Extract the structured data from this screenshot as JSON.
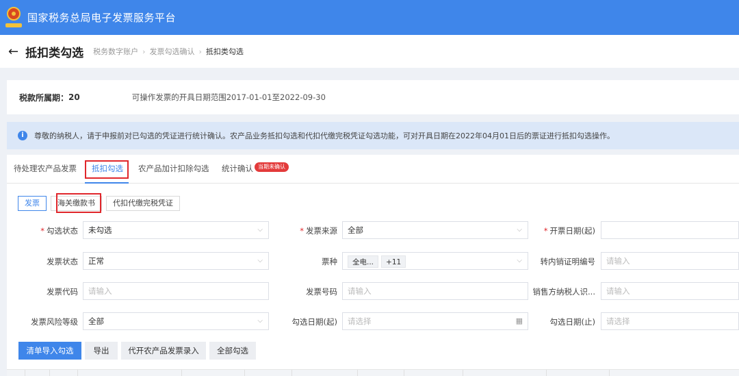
{
  "app": {
    "title": "国家税务总局电子发票服务平台"
  },
  "header": {
    "back_icon": "←",
    "title": "抵扣类勾选",
    "breadcrumbs": [
      "税务数字账户",
      "发票勾选确认",
      "抵扣类勾选"
    ],
    "sep": "›"
  },
  "period": {
    "label": "税款所属期：",
    "value": "20",
    "range_text": "可操作发票的开具日期范围2017-01-01至2022-09-30"
  },
  "notice": {
    "icon": "i",
    "text": "尊敬的纳税人，请于申报前对已勾选的凭证进行统计确认。农产品业务抵扣勾选和代扣代缴完税凭证勾选功能，可对开具日期在2022年04月01日后的票证进行抵扣勾选操作。"
  },
  "tabs": [
    {
      "label": "待处理农产品发票"
    },
    {
      "label": "抵扣勾选"
    },
    {
      "label": "农产品加计扣除勾选"
    },
    {
      "label": "统计确认"
    }
  ],
  "badge": "当期未确认",
  "subtabs": [
    {
      "label": "发票"
    },
    {
      "label": "海关缴款书"
    },
    {
      "label": "代扣代缴完税凭证"
    }
  ],
  "form": {
    "check_status": {
      "label": "勾选状态",
      "value": "未勾选"
    },
    "invoice_source": {
      "label": "发票来源",
      "value": "全部"
    },
    "issue_date_start": {
      "label": "开票日期(起)",
      "value": ""
    },
    "invoice_status": {
      "label": "发票状态",
      "value": "正常"
    },
    "ticket_type": {
      "label": "票种",
      "chip": "全电...",
      "more": "+11"
    },
    "transfer_cert_no": {
      "label": "转内销证明编号",
      "placeholder": "请输入"
    },
    "invoice_code": {
      "label": "发票代码",
      "placeholder": "请输入"
    },
    "invoice_number": {
      "label": "发票号码",
      "placeholder": "请输入"
    },
    "seller_tax_id": {
      "label": "销售方纳税人识...",
      "placeholder": "请输入"
    },
    "risk_level": {
      "label": "发票风险等级",
      "value": "全部"
    },
    "check_date_start": {
      "label": "勾选日期(起)",
      "placeholder": "请选择"
    },
    "check_date_end": {
      "label": "勾选日期(止)",
      "placeholder": "请选择"
    }
  },
  "buttons": {
    "import": "清单导入勾选",
    "export": "导出",
    "agri_entry": "代开农产品发票录入",
    "select_all": "全部勾选"
  },
  "colors": {
    "primary": "#3f86ea",
    "highlight": "#e0262b"
  }
}
